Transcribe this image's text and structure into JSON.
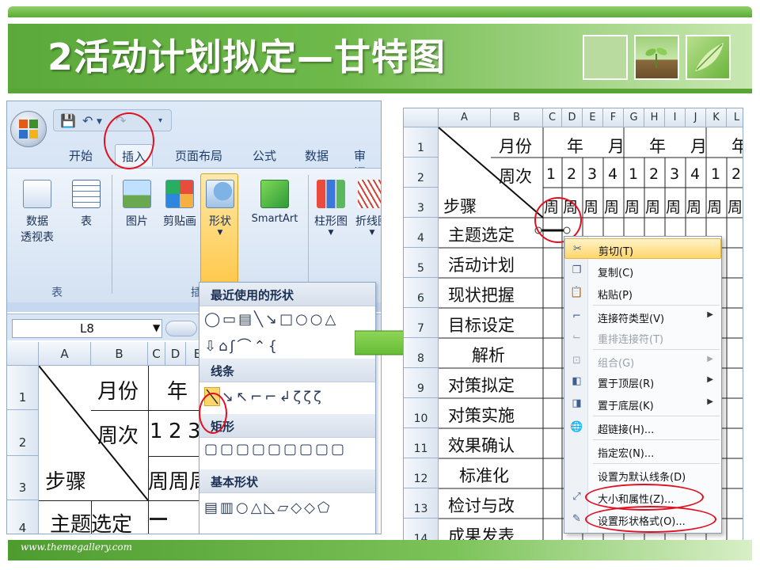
{
  "slide": {
    "title": "2活动计划拟定—甘特图",
    "footer": "www.themegallery.com"
  },
  "excel_left": {
    "tabs": [
      "开始",
      "插入",
      "页面布局",
      "公式",
      "数据",
      "审阅"
    ],
    "ribbon": {
      "pivot_label_1": "数据",
      "pivot_label_2": "透视表",
      "table_label": "表",
      "picture_label": "图片",
      "clipart_label": "剪贴画",
      "shapes_label": "形状",
      "smartart_label": "SmartArt",
      "column_chart_label": "柱形图",
      "line_chart_label": "折线图",
      "group_tables_label": "表",
      "group_illustrations_label": "插"
    },
    "namebox": "L8",
    "columns": [
      "A",
      "B",
      "C",
      "D",
      "E"
    ],
    "rows": [
      "1",
      "2",
      "3",
      "4"
    ],
    "cells": {
      "month": "月份",
      "year": "年",
      "week": "周次",
      "nums": [
        "1",
        "2",
        "3"
      ],
      "step": "步骤",
      "weeks": [
        "周",
        "周",
        "周"
      ],
      "topic": "主题选定"
    },
    "shapes_gallery": {
      "recent": "最近使用的形状",
      "lines": "线条",
      "rect": "矩形",
      "basic": "基本形状"
    }
  },
  "excel_right": {
    "columns": [
      "A",
      "B",
      "C",
      "D",
      "E",
      "F",
      "G",
      "H",
      "I",
      "J",
      "K",
      "L"
    ],
    "rows": [
      "1",
      "2",
      "3",
      "4",
      "5",
      "6",
      "7",
      "8",
      "9",
      "10",
      "11",
      "12",
      "13",
      "14"
    ],
    "header": {
      "month": "月份",
      "week": "周次",
      "step": "步骤",
      "month_row": [
        "年",
        "月",
        "年",
        "月",
        "年"
      ],
      "week_nums": [
        "1",
        "2",
        "3",
        "4",
        "1",
        "2",
        "3",
        "4",
        "1",
        "2"
      ],
      "week_char": "周"
    },
    "steps": [
      "主题选定",
      "活动计划",
      "现状把握",
      "目标设定",
      "解析",
      "对策拟定",
      "对策实施",
      "效果确认",
      "标准化",
      "检讨与改",
      "成果发表"
    ],
    "context_menu": [
      {
        "label": "剪切(T)",
        "icon": "scissors-icon",
        "state": "highlighted"
      },
      {
        "label": "复制(C)",
        "icon": "copy-icon",
        "state": "normal"
      },
      {
        "label": "粘贴(P)",
        "icon": "paste-icon",
        "state": "normal"
      },
      {
        "label": "连接符类型(V)",
        "icon": "connector-icon",
        "state": "submenu"
      },
      {
        "label": "重排连接符(T)",
        "icon": "reroute-icon",
        "state": "disabled"
      },
      {
        "label": "组合(G)",
        "icon": "group-icon",
        "state": "disabled-submenu"
      },
      {
        "label": "置于顶层(R)",
        "icon": "bring-front-icon",
        "state": "submenu"
      },
      {
        "label": "置于底层(K)",
        "icon": "send-back-icon",
        "state": "submenu"
      },
      {
        "label": "超链接(H)...",
        "icon": "hyperlink-icon",
        "state": "normal"
      },
      {
        "label": "指定宏(N)...",
        "icon": "",
        "state": "normal"
      },
      {
        "label": "设置为默认线条(D)",
        "icon": "",
        "state": "normal"
      },
      {
        "label": "大小和属性(Z)...",
        "icon": "size-icon",
        "state": "circled"
      },
      {
        "label": "设置形状格式(O)...",
        "icon": "format-shape-icon",
        "state": "circled"
      }
    ]
  },
  "colors": {
    "brand_green": "#58a437",
    "highlight_red": "#e01020",
    "ribbon_blue": "#c5d8ef",
    "menu_highlight": "#ffd66b"
  }
}
